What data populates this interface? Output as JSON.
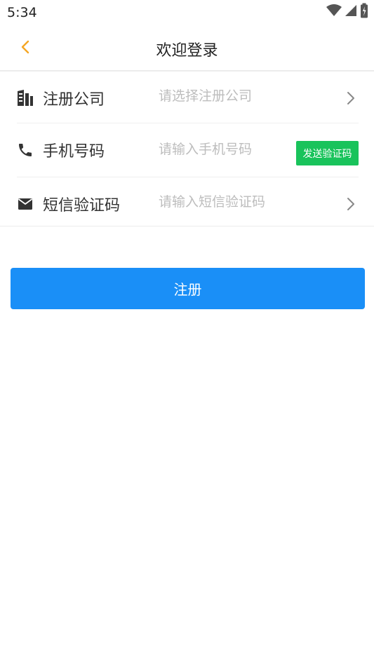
{
  "status_bar": {
    "time": "5:34",
    "icons": [
      "wifi-icon",
      "cellular-signal-icon",
      "battery-icon"
    ]
  },
  "header": {
    "title": "欢迎登录",
    "back_icon": "chevron-left-icon",
    "accent_color": "#f5a623"
  },
  "form": {
    "rows": [
      {
        "label": "注册公司",
        "placeholder": "请选择注册公司",
        "icon": "building-icon",
        "trailing": "chevron-right-icon"
      },
      {
        "label": "手机号码",
        "placeholder": "请输入手机号码",
        "icon": "phone-icon",
        "trailing_button": "发送验证码"
      },
      {
        "label": "短信验证码",
        "placeholder": "请输入短信验证码",
        "icon": "mail-icon",
        "trailing": "chevron-right-icon"
      }
    ]
  },
  "colors": {
    "send_code_bg": "#19c35b",
    "primary": "#1a8ff7"
  },
  "register_button": {
    "label": "注册"
  }
}
